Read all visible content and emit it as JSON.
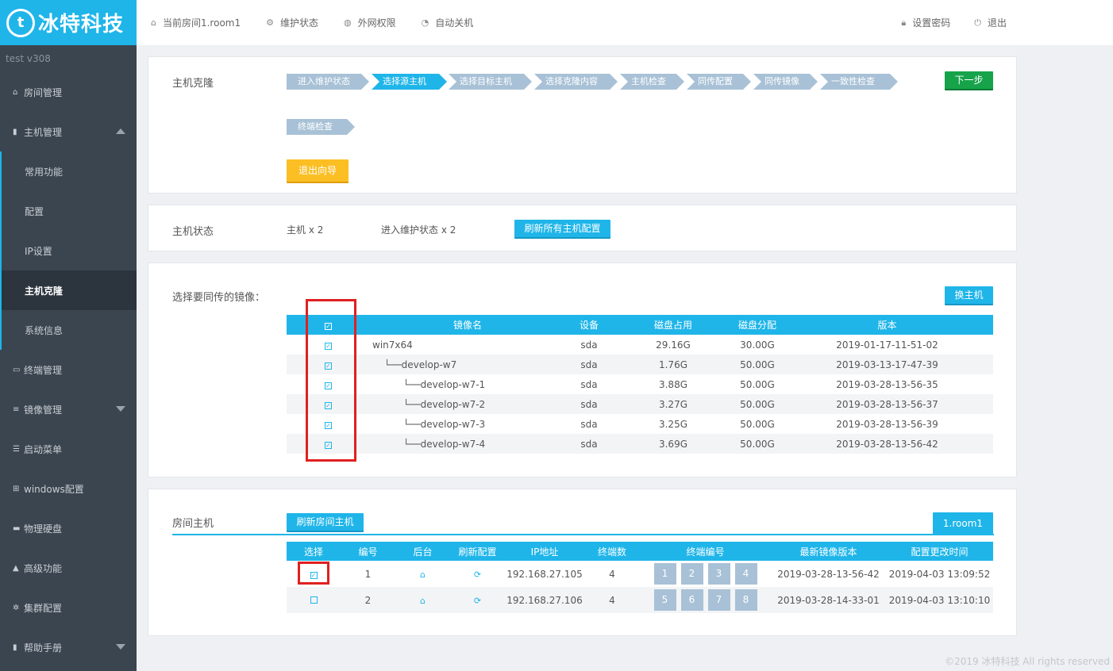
{
  "brand": {
    "logo_letter": "t",
    "name": "冰特科技",
    "version": "test  v308"
  },
  "sidebar": {
    "items": [
      {
        "icon": "home-icon",
        "glyph": "⌂",
        "label": "房间管理"
      },
      {
        "icon": "server-icon",
        "glyph": "▮",
        "label": "主机管理"
      },
      {
        "label": "常用功能"
      },
      {
        "label": "配置"
      },
      {
        "label": "IP设置"
      },
      {
        "label": "主机克隆"
      },
      {
        "label": "系统信息"
      },
      {
        "icon": "monitor-icon",
        "glyph": "▭",
        "label": "终端管理"
      },
      {
        "icon": "database-icon",
        "glyph": "≡",
        "label": "镜像管理"
      },
      {
        "icon": "menu-icon",
        "glyph": "☰",
        "label": "启动菜单"
      },
      {
        "icon": "windows-icon",
        "glyph": "⊞",
        "label": "windows配置"
      },
      {
        "icon": "harddisk-icon",
        "glyph": "▬",
        "label": "物理硬盘"
      },
      {
        "icon": "warning-icon",
        "glyph": "▲",
        "label": "高级功能"
      },
      {
        "icon": "cluster-gear-icon",
        "glyph": "✲",
        "label": "集群配置"
      },
      {
        "icon": "book-icon",
        "glyph": "▮",
        "label": "帮助手册"
      }
    ]
  },
  "topbar": {
    "current_room": "当前房间1.room1",
    "maintenance": "维护状态",
    "network": "外网权限",
    "shutdown": "自动关机",
    "set_password": "设置密码",
    "logout": "退出"
  },
  "clone_panel": {
    "title": "主机克隆",
    "steps": [
      "进入维护状态",
      "选择源主机",
      "选择目标主机",
      "选择克隆内容",
      "主机检查",
      "同传配置",
      "同传镜像",
      "一致性检查",
      "终端检查"
    ],
    "current_step": "选择源主机",
    "next_label": "下一步",
    "exit_label": "退出向导"
  },
  "status_panel": {
    "title": "主机状态",
    "host_count": "主机 x 2",
    "maintenance_count": "进入维护状态 x 2",
    "refresh_label": "刷新所有主机配置"
  },
  "image_panel": {
    "title": "选择要同传的镜像：",
    "switch_label": "换主机",
    "columns": [
      "镜像名",
      "设备",
      "磁盘占用",
      "磁盘分配",
      "版本"
    ],
    "rows": [
      {
        "name": "win7x64",
        "device": "sda",
        "used": "29.16G",
        "alloc": "30.00G",
        "version": "2019-01-17-11-51-02"
      },
      {
        "name": "└──develop-w7",
        "device": "sda",
        "used": "1.76G",
        "alloc": "50.00G",
        "version": "2019-03-13-17-47-39"
      },
      {
        "name": "└──develop-w7-1",
        "device": "sda",
        "used": "3.88G",
        "alloc": "50.00G",
        "version": "2019-03-28-13-56-35"
      },
      {
        "name": "└──develop-w7-2",
        "device": "sda",
        "used": "3.27G",
        "alloc": "50.00G",
        "version": "2019-03-28-13-56-37"
      },
      {
        "name": "└──develop-w7-3",
        "device": "sda",
        "used": "3.25G",
        "alloc": "50.00G",
        "version": "2019-03-28-13-56-39"
      },
      {
        "name": "└──develop-w7-4",
        "device": "sda",
        "used": "3.69G",
        "alloc": "50.00G",
        "version": "2019-03-28-13-56-42"
      }
    ]
  },
  "room_panel": {
    "title": "房间主机",
    "refresh_label": "刷新房间主机",
    "room_tab": "1.room1",
    "columns": [
      "选择",
      "编号",
      "后台",
      "刷新配置",
      "IP地址",
      "终端数",
      "终端编号",
      "最新镜像版本",
      "配置更改时间"
    ],
    "rows": [
      {
        "checked": true,
        "id": "1",
        "ip": "192.168.27.105",
        "terminals": "4",
        "terminal_ids": [
          "1",
          "2",
          "3",
          "4"
        ],
        "image_version": "2019-03-28-13-56-42",
        "changed": "2019-04-03 13:09:52"
      },
      {
        "checked": false,
        "id": "2",
        "ip": "192.168.27.106",
        "terminals": "4",
        "terminal_ids": [
          "5",
          "6",
          "7",
          "8"
        ],
        "image_version": "2019-03-28-14-33-01",
        "changed": "2019-04-03 13:10:10"
      }
    ]
  },
  "footer": "©2019 冰特科技 All rights reserved",
  "colors": {
    "accent": "#1fb5e9",
    "sidebar": "#3b4550",
    "step": "#a8c1d6",
    "next": "#16a34a",
    "exit": "#fbbf24",
    "highlight": "#e02020"
  }
}
